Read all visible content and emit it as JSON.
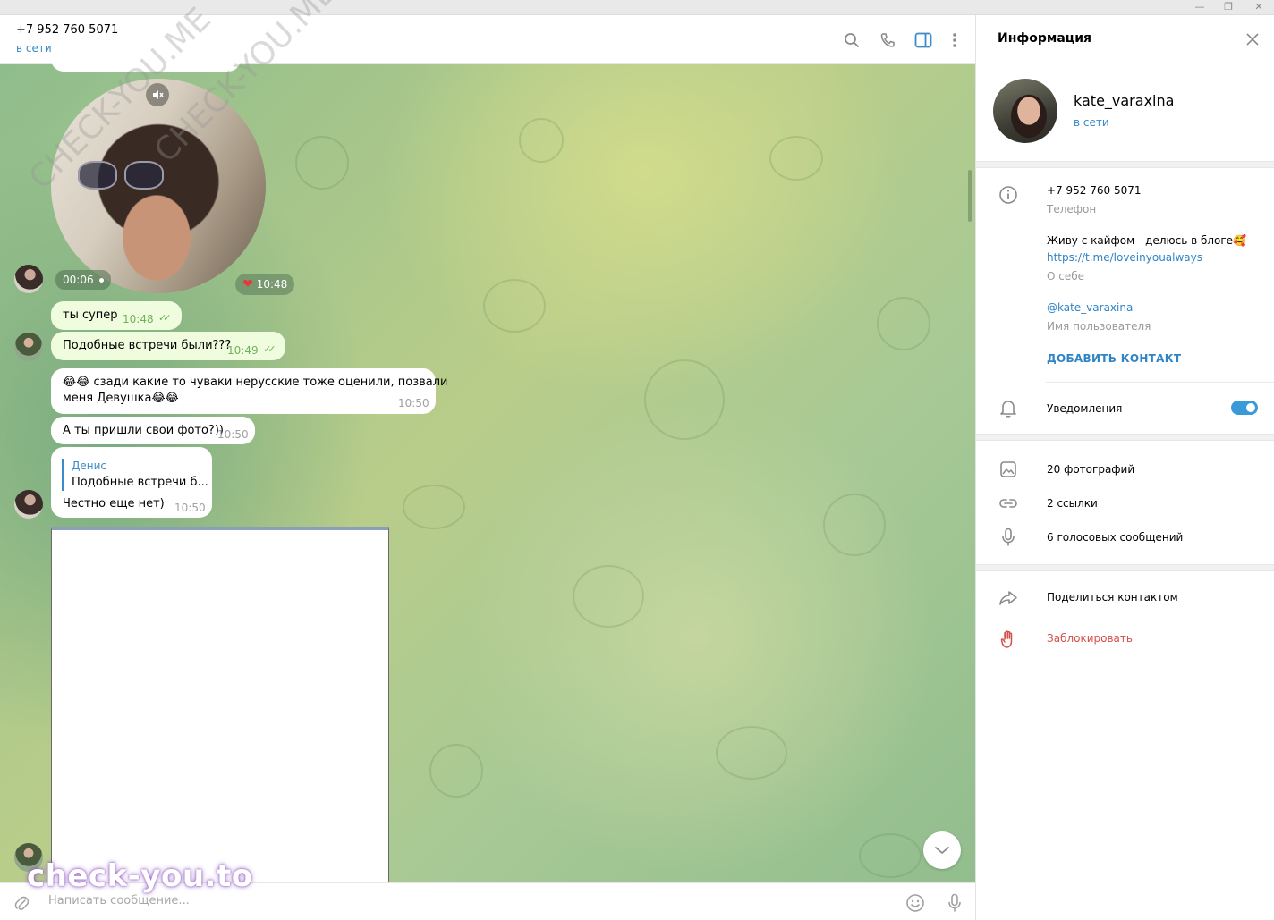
{
  "window": {
    "minimize": "—",
    "maximize": "❐",
    "close": "✕"
  },
  "chat": {
    "title": "+7 952 760 5071",
    "status": "в сети",
    "header_icons": [
      "search-icon",
      "phone-icon",
      "sidebar-toggle-icon",
      "more-vertical-icon"
    ]
  },
  "video_note": {
    "duration": "00:06",
    "time": "10:48",
    "reaction": "❤"
  },
  "messages": [
    {
      "text": "ты супер",
      "time": "10:48",
      "outgoing": true,
      "read": true
    },
    {
      "text": "Подобные встречи были???",
      "time": "10:49",
      "outgoing": true,
      "read": true
    },
    {
      "text": "😂😂 сзади какие то чуваки нерусские тоже оценили, позвали меня Девушка😂😂",
      "line1": "😂😂 сзади какие то чуваки нерусские тоже оценили, позвали",
      "line2": "меня Девушка😂😂",
      "time": "10:50",
      "outgoing": false
    },
    {
      "text": "А ты пришли свои фото?))",
      "time": "10:50",
      "outgoing": false
    },
    {
      "reply_author": "Денис",
      "reply_text": "Подобные встречи б...",
      "text": "Честно еще нет)",
      "time": "10:50",
      "outgoing": false
    }
  ],
  "composer": {
    "placeholder": "Написать сообщение..."
  },
  "watermark": "check-you.to",
  "watermark_diagonal": "CHECK-YOU.ME",
  "info": {
    "title": "Информация",
    "name": "kate_varaxina",
    "status": "в сети",
    "phone": "+7 952 760 5071",
    "phone_caption": "Телефон",
    "bio": "Живу с кайфом - делюсь в блоге🥰",
    "bio_link": "https://t.me/loveinyoualways",
    "bio_caption": "О себе",
    "username": "@kate_varaxina",
    "username_caption": "Имя пользователя",
    "add_contact": "ДОБАВИТЬ КОНТАКТ",
    "notifications": "Уведомления",
    "notifications_on": true,
    "media": [
      {
        "label": "20 фотографий",
        "icon": "photo-icon"
      },
      {
        "label": "2 ссылки",
        "icon": "link-icon"
      },
      {
        "label": "6 голосовых сообщений",
        "icon": "microphone-icon"
      }
    ],
    "share": "Поделиться контактом",
    "block": "Заблокировать"
  },
  "colors": {
    "accent": "#3a8bc9",
    "outgoing_bubble": "#effdde",
    "danger": "#d4504a"
  }
}
